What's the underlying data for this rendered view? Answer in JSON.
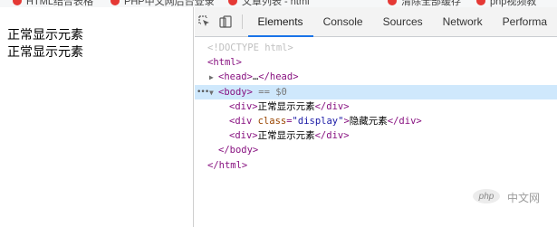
{
  "bookmarks": [
    {
      "label": "HTML结合表格"
    },
    {
      "label": "PHP中文网后台登录"
    },
    {
      "label": "文章列表 - html"
    },
    {
      "label": "清除全部缓存"
    },
    {
      "label": "php视频教"
    }
  ],
  "viewport": {
    "lines": [
      "正常显示元素",
      "正常显示元素"
    ]
  },
  "devtools": {
    "tabs": [
      "Elements",
      "Console",
      "Sources",
      "Network",
      "Performa"
    ],
    "active_tab": "Elements",
    "dom": {
      "doctype": "<!DOCTYPE html>",
      "html_open": "<html>",
      "head_open": "<head>",
      "head_ellipsis": "…",
      "head_close": "</head>",
      "body_open": "<body>",
      "body_marker": "== $0",
      "div_open": "<div>",
      "div_close": "</div>",
      "div1_text": "正常显示元素",
      "div2_open_start": "<div ",
      "div2_attr_name": "class",
      "div2_attr_eq": "=",
      "div2_attr_value": "\"display\"",
      "div2_open_end": ">",
      "div2_text": "隐藏元素",
      "div3_text": "正常显示元素",
      "body_close": "</body>",
      "html_close": "</html>",
      "dots": "•••"
    }
  },
  "watermark": {
    "logo_text": "php",
    "text": "中文网"
  }
}
